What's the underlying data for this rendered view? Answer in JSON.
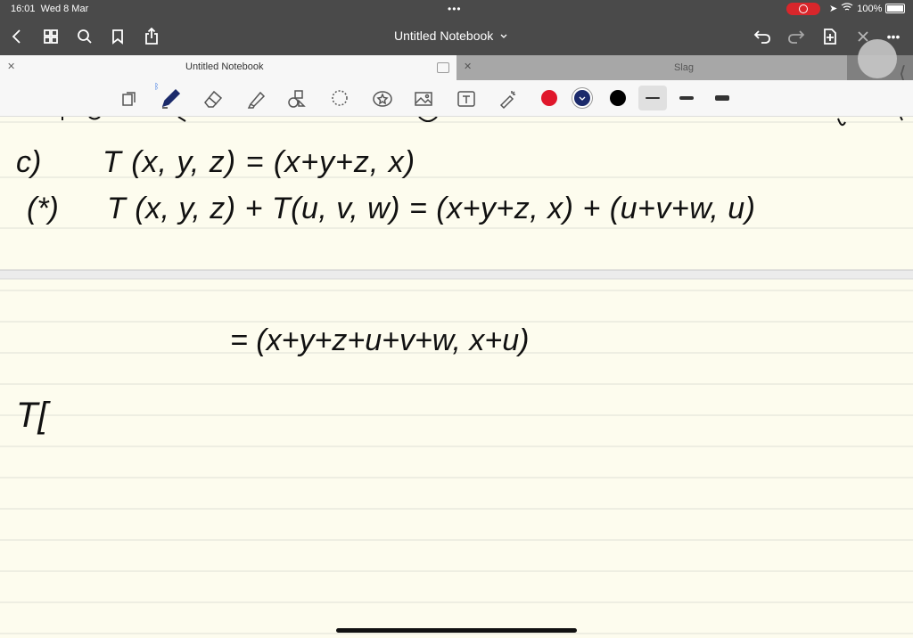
{
  "status": {
    "time": "16:01",
    "date": "Wed 8 Mar",
    "battery": "100%"
  },
  "nav": {
    "title": "Untitled Notebook"
  },
  "tabs": [
    {
      "label": "Untitled Notebook",
      "active": true
    },
    {
      "label": "Slag",
      "active": false
    }
  ],
  "colors": {
    "accent_red": "#e0172b",
    "accent_navy": "#1b2a6b",
    "ink": "#000000",
    "paper": "#fdfcee"
  },
  "tools": [
    "document-icon",
    "pen-icon",
    "eraser-icon",
    "highlighter-icon",
    "shapes-icon",
    "lasso-icon",
    "sticker-icon",
    "image-icon",
    "text-icon",
    "laser-icon"
  ],
  "handwriting": {
    "line_c_label": "c)",
    "line_c": "T (x, y, z) = (x+y+z, x)",
    "line_star_label": "(*)",
    "line_star": "T (x, y, z) + T(u, v, w) = (x+y+z, x) + (u+v+w, u)",
    "line_eq": "= (x+y+z+u+v+w, x+u)",
    "line_t": "T["
  }
}
